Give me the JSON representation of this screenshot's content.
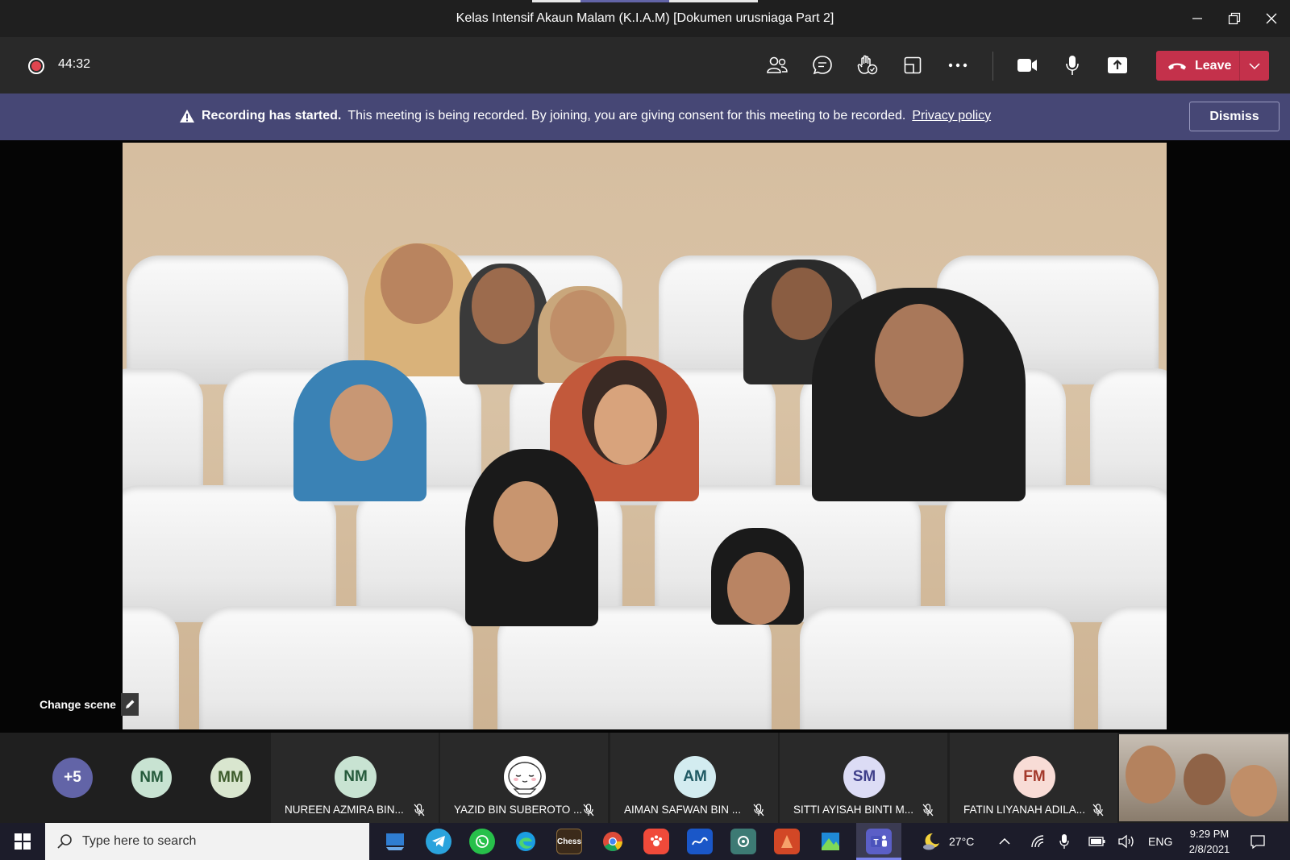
{
  "window": {
    "title": "Kelas Intensif Akaun Malam (K.I.A.M) [Dokumen urusniaga Part 2]"
  },
  "controls": {
    "timer": "44:32",
    "leave_label": "Leave"
  },
  "banner": {
    "bold": "Recording has started.",
    "message": "This meeting is being recorded. By joining, you are giving consent for this meeting to be recorded.",
    "link": "Privacy policy",
    "dismiss_label": "Dismiss"
  },
  "stage": {
    "change_scene_label": "Change scene"
  },
  "participants": {
    "overflow": "+5",
    "small": [
      {
        "initials": "NM",
        "bg": "#c8e3d2",
        "fg": "#255a3b"
      },
      {
        "initials": "MM",
        "bg": "#d9e6cf",
        "fg": "#3c5a2a"
      }
    ],
    "tiles": [
      {
        "initials": "NM",
        "name": "NUREEN AZMIRA BIN...",
        "bg": "#c8e3d2",
        "fg": "#255a3b"
      },
      {
        "initials": "",
        "name": "YAZID BIN SUBEROTO ...",
        "bg": "#ffffff",
        "fg": "#333333"
      },
      {
        "initials": "AM",
        "name": "AIMAN SAFWAN BIN ...",
        "bg": "#d3ecf0",
        "fg": "#1f5963"
      },
      {
        "initials": "SM",
        "name": "SITTI AYISAH BINTI M...",
        "bg": "#dcdcf5",
        "fg": "#3f3f8a"
      },
      {
        "initials": "FM",
        "name": "FATIN LIYANAH ADILA...",
        "bg": "#f8dcd6",
        "fg": "#a3392b"
      }
    ]
  },
  "taskbar": {
    "search_placeholder": "Type here to search",
    "chess_label": "Chess",
    "temperature": "27°C",
    "language": "ENG",
    "time": "9:29 PM",
    "date": "2/8/2021"
  },
  "colors": {
    "leave": "#c4314b",
    "banner": "#464775",
    "teams_accent": "#6264a7"
  }
}
